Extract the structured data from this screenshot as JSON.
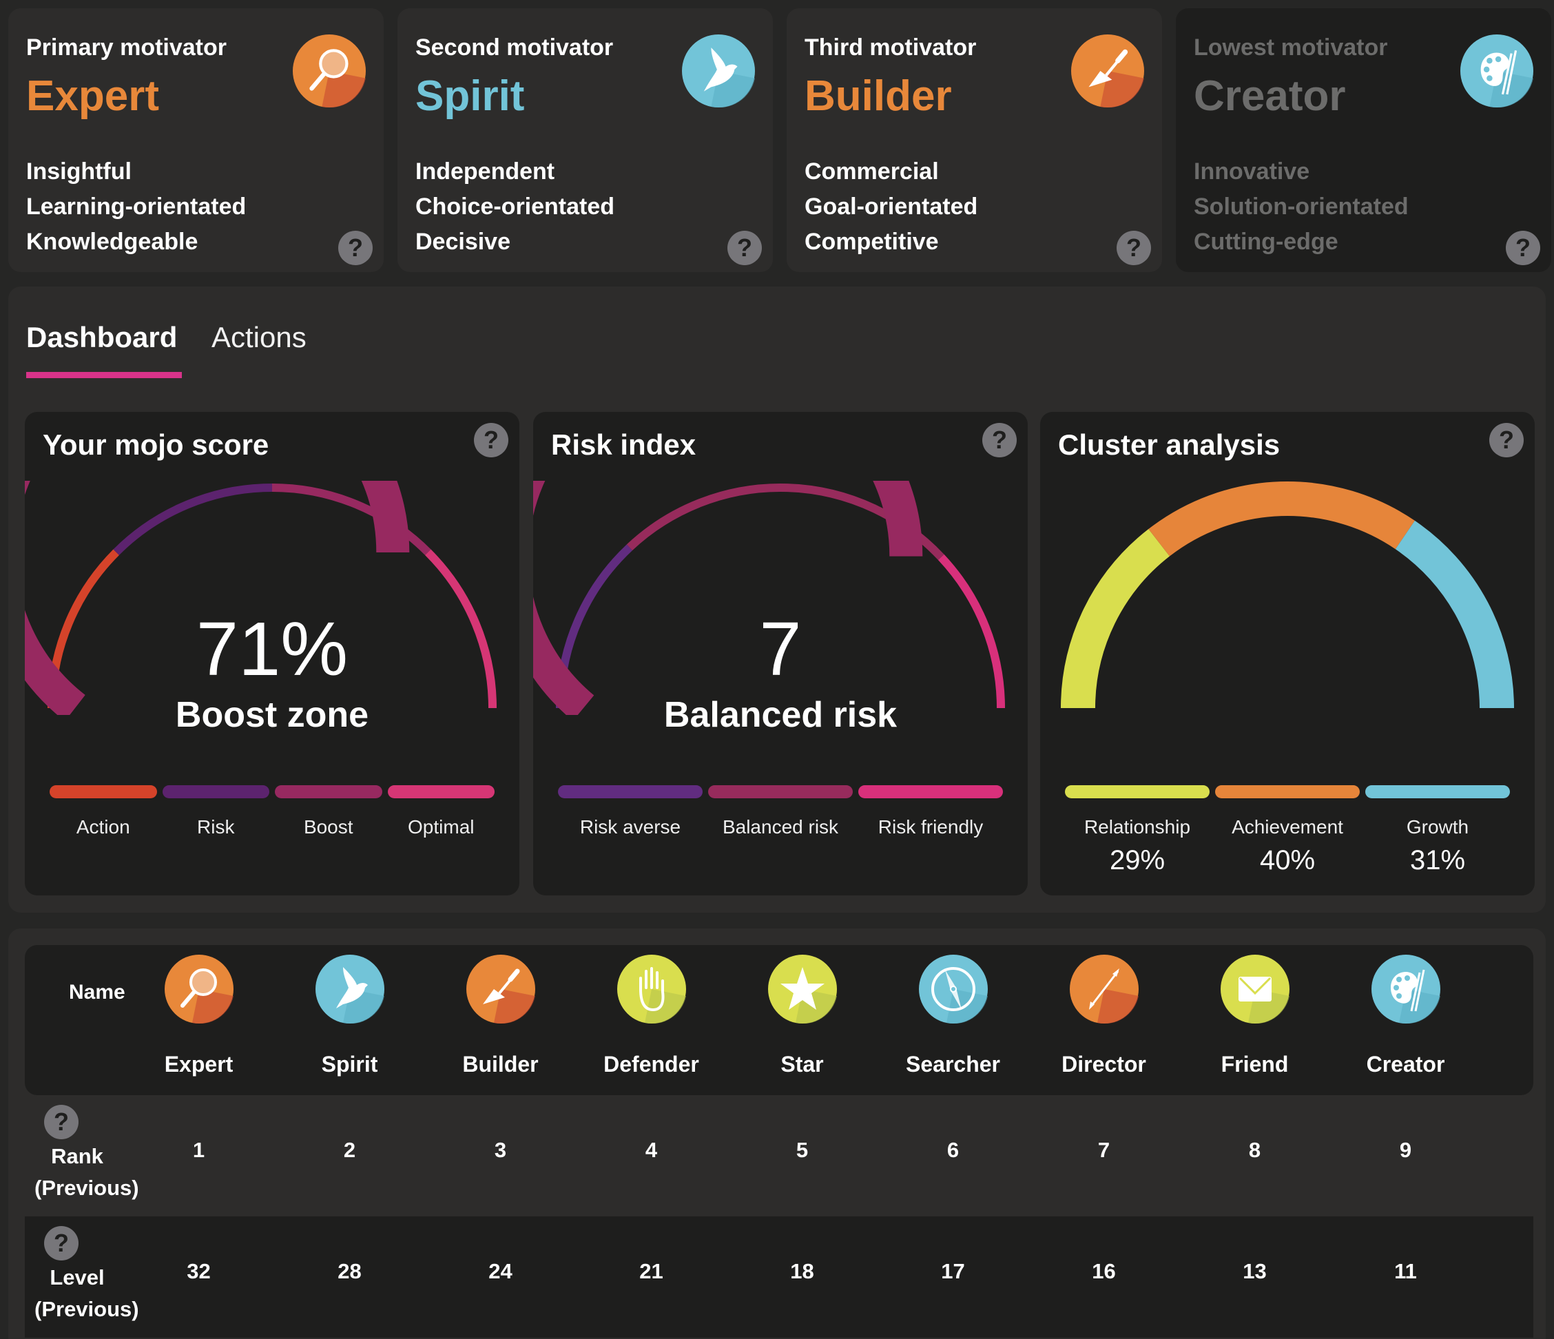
{
  "motivators": [
    {
      "label": "Primary motivator",
      "name": "Expert",
      "color": "#e8883a",
      "icon": "magnifier-icon",
      "traits": [
        "Insightful",
        "Learning-orientated",
        "Knowledgeable"
      ]
    },
    {
      "label": "Second motivator",
      "name": "Spirit",
      "color": "#72c4d8",
      "icon": "dove-icon",
      "traits": [
        "Independent",
        "Choice-orientated",
        "Decisive"
      ]
    },
    {
      "label": "Third motivator",
      "name": "Builder",
      "color": "#e8883a",
      "icon": "trowel-icon",
      "traits": [
        "Commercial",
        "Goal-orientated",
        "Competitive"
      ]
    },
    {
      "label": "Lowest motivator",
      "name": "Creator",
      "color": "#6c6c6b",
      "icon": "palette-icon",
      "traits": [
        "Innovative",
        "Solution-orientated",
        "Cutting-edge"
      ]
    }
  ],
  "help_glyph": "?",
  "tabs": [
    {
      "label": "Dashboard",
      "active": true
    },
    {
      "label": "Actions",
      "active": false
    }
  ],
  "mojo": {
    "title": "Your mojo score",
    "value": "71%",
    "value_fraction": 0.71,
    "zone": "Boost zone",
    "legend": [
      {
        "label": "Action",
        "color": "#d5432a"
      },
      {
        "label": "Risk",
        "color": "#5c236e"
      },
      {
        "label": "Boost",
        "color": "#972960"
      },
      {
        "label": "Optimal",
        "color": "#d63675"
      }
    ]
  },
  "risk": {
    "title": "Risk index",
    "value": "7",
    "value_fraction": 0.72,
    "zone": "Balanced risk",
    "legend": [
      {
        "label": "Risk averse",
        "color": "#612c80"
      },
      {
        "label": "Balanced risk",
        "color": "#972b5c"
      },
      {
        "label": "Risk friendly",
        "color": "#d8307b"
      }
    ]
  },
  "cluster": {
    "title": "Cluster analysis",
    "segments": [
      {
        "label": "Relationship",
        "percent": 29,
        "display": "29%",
        "color": "#d9de4e"
      },
      {
        "label": "Achievement",
        "percent": 40,
        "display": "40%",
        "color": "#e6853a"
      },
      {
        "label": "Growth",
        "percent": 31,
        "display": "31%",
        "color": "#72c4d8"
      }
    ]
  },
  "table": {
    "name_header": "Name",
    "rank_label": [
      "Rank",
      "(Previous)"
    ],
    "level_label": [
      "Level",
      "(Previous)"
    ],
    "columns": [
      {
        "name": "Expert",
        "icon": "magnifier-icon",
        "color": "#e8883a",
        "rank": "1",
        "level": "32"
      },
      {
        "name": "Spirit",
        "icon": "dove-icon",
        "color": "#72c4d8",
        "rank": "2",
        "level": "28"
      },
      {
        "name": "Builder",
        "icon": "trowel-icon",
        "color": "#e8883a",
        "rank": "3",
        "level": "24"
      },
      {
        "name": "Defender",
        "icon": "hand-icon",
        "color": "#d9de4e",
        "rank": "4",
        "level": "21"
      },
      {
        "name": "Star",
        "icon": "star-icon",
        "color": "#d9de4e",
        "rank": "5",
        "level": "18"
      },
      {
        "name": "Searcher",
        "icon": "compass-icon",
        "color": "#72c4d8",
        "rank": "6",
        "level": "17"
      },
      {
        "name": "Director",
        "icon": "arrow-icon",
        "color": "#e8883a",
        "rank": "7",
        "level": "16"
      },
      {
        "name": "Friend",
        "icon": "envelope-icon",
        "color": "#d9de4e",
        "rank": "8",
        "level": "13"
      },
      {
        "name": "Creator",
        "icon": "palette-icon",
        "color": "#72c4d8",
        "rank": "9",
        "level": "11"
      }
    ]
  }
}
